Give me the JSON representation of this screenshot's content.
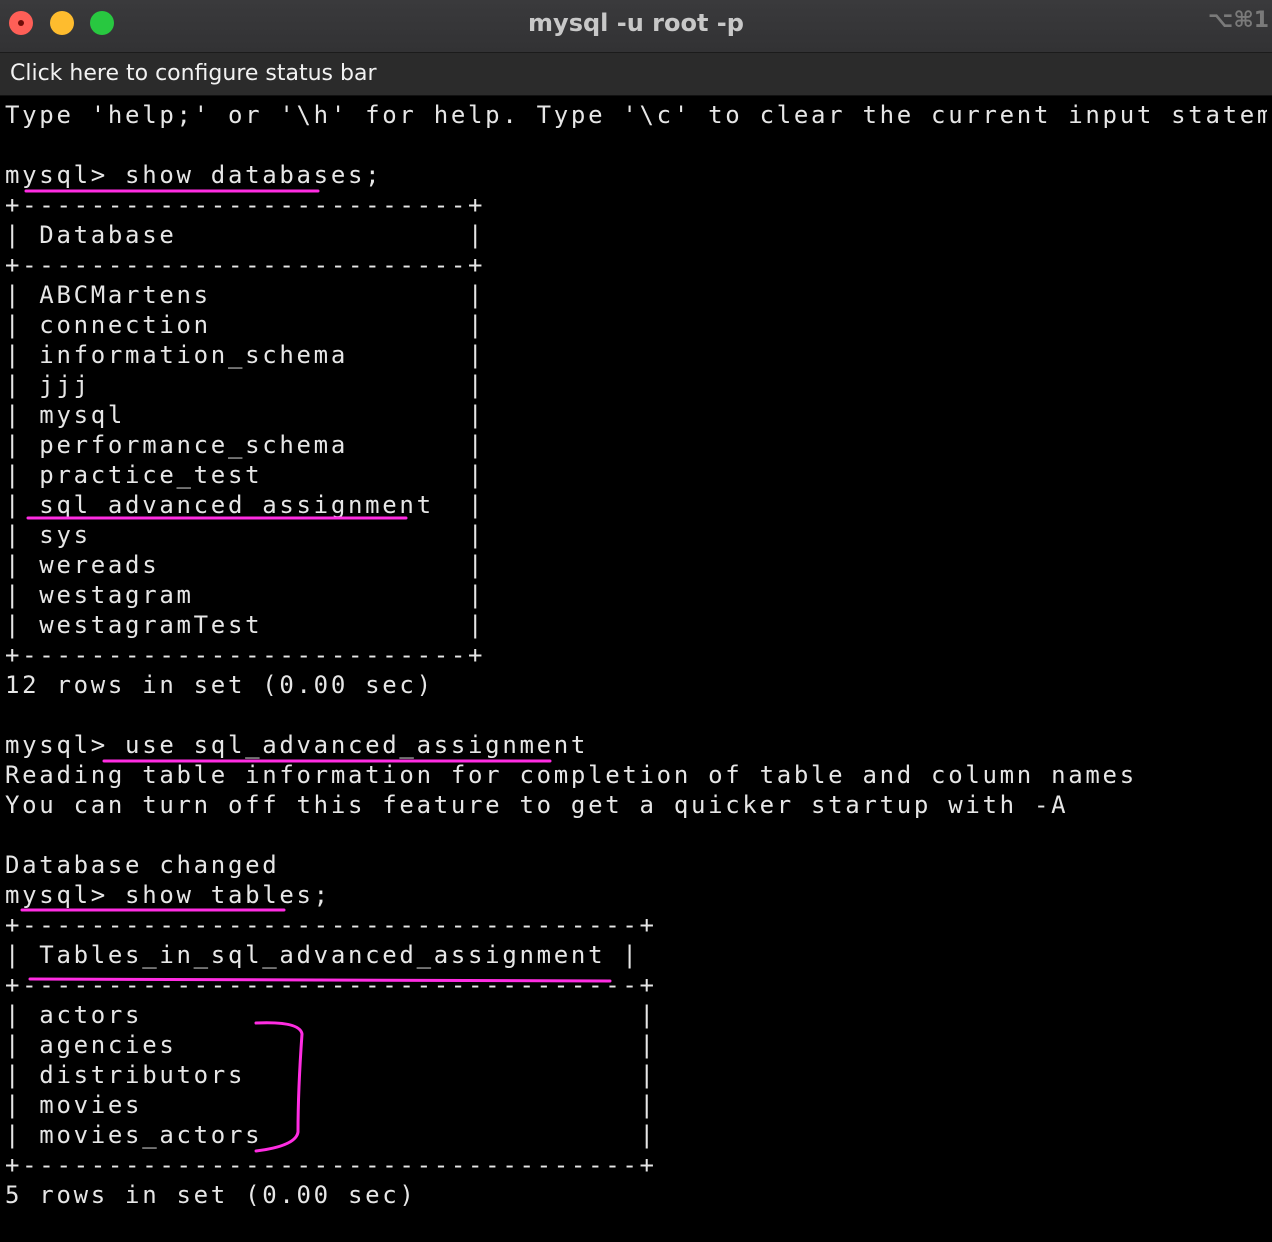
{
  "window": {
    "title": "mysql -u root -p",
    "shortcut": "⌥⌘1"
  },
  "status_bar": {
    "label": "Click here to configure status bar"
  },
  "terminal": {
    "lines": [
      "Type 'help;' or '\\h' for help. Type '\\c' to clear the current input statement.",
      "",
      "mysql> show databases;",
      "+--------------------------+",
      "| Database                 |",
      "+--------------------------+",
      "| ABCMartens               |",
      "| connection               |",
      "| information_schema       |",
      "| jjj                      |",
      "| mysql                    |",
      "| performance_schema       |",
      "| practice_test            |",
      "| sql_advanced_assignment  |",
      "| sys                      |",
      "| wereads                  |",
      "| westagram                |",
      "| westagramTest            |",
      "+--------------------------+",
      "12 rows in set (0.00 sec)",
      "",
      "mysql> use sql_advanced_assignment",
      "Reading table information for completion of table and column names",
      "You can turn off this feature to get a quicker startup with -A",
      "",
      "Database changed",
      "mysql> show tables;",
      "+------------------------------------+",
      "| Tables_in_sql_advanced_assignment |",
      "+------------------------------------+",
      "| actors                             |",
      "| agencies                           |",
      "| distributors                       |",
      "| movies                             |",
      "| movies_actors                      |",
      "+------------------------------------+",
      "5 rows in set (0.00 sec)"
    ]
  },
  "annotations": {
    "color": "#ff2de2"
  }
}
